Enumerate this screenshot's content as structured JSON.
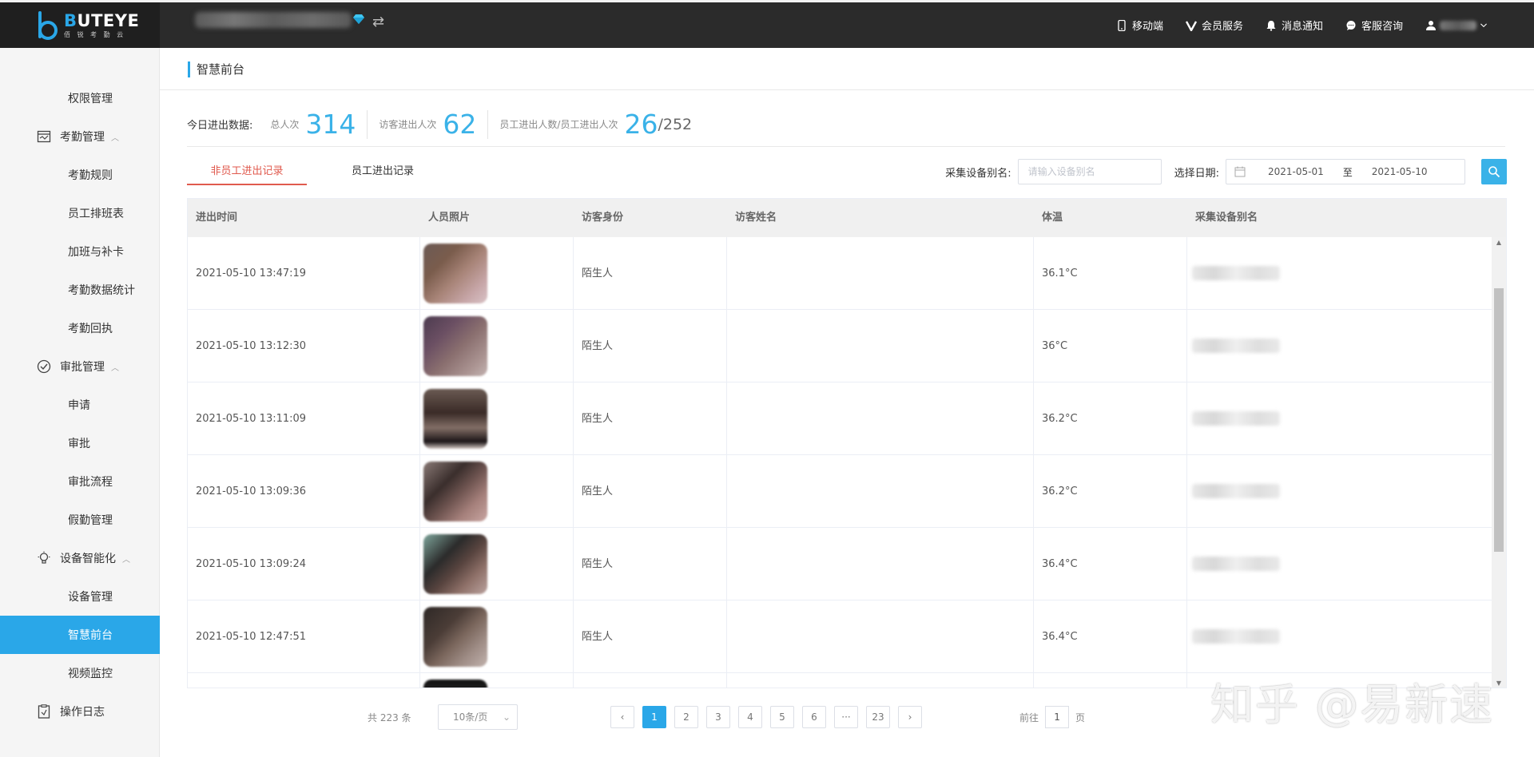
{
  "brand": {
    "name_a": "B",
    "name_b": "UTEYE",
    "tagline": "佰 锐 考 勤 云"
  },
  "topnav": [
    {
      "label": "移动端",
      "icon": "mobile-icon"
    },
    {
      "label": "会员服务",
      "icon": "vip-icon"
    },
    {
      "label": "消息通知",
      "icon": "bell-icon"
    },
    {
      "label": "客服咨询",
      "icon": "chat-icon"
    }
  ],
  "sidebar": {
    "items": [
      {
        "label": "权限管理",
        "type": "sub"
      },
      {
        "label": "考勤管理",
        "type": "group",
        "icon": "calendar-icon"
      },
      {
        "label": "考勤规则",
        "type": "sub"
      },
      {
        "label": "员工排班表",
        "type": "sub"
      },
      {
        "label": "加班与补卡",
        "type": "sub"
      },
      {
        "label": "考勤数据统计",
        "type": "sub"
      },
      {
        "label": "考勤回执",
        "type": "sub"
      },
      {
        "label": "审批管理",
        "type": "group",
        "icon": "check-circle-icon"
      },
      {
        "label": "申请",
        "type": "sub"
      },
      {
        "label": "审批",
        "type": "sub"
      },
      {
        "label": "审批流程",
        "type": "sub"
      },
      {
        "label": "假勤管理",
        "type": "sub"
      },
      {
        "label": "设备智能化",
        "type": "group",
        "icon": "bulb-icon"
      },
      {
        "label": "设备管理",
        "type": "sub"
      },
      {
        "label": "智慧前台",
        "type": "sub",
        "active": true
      },
      {
        "label": "视频监控",
        "type": "sub"
      },
      {
        "label": "操作日志",
        "type": "group",
        "icon": "log-icon"
      }
    ]
  },
  "page": {
    "title": "智慧前台"
  },
  "stats": {
    "lead": "今日进出数据:",
    "total_label": "总人次",
    "total_value": "314",
    "visitor_label": "访客进出人次",
    "visitor_value": "62",
    "staff_label": "员工进出人数/员工进出人次",
    "staff_value": "26",
    "staff_total": "/252"
  },
  "tabs": [
    "非员工进出记录",
    "员工进出记录"
  ],
  "filters": {
    "device_label": "采集设备别名:",
    "device_placeholder": "请输入设备别名",
    "date_label": "选择日期:",
    "date_start": "2021-05-01",
    "date_sep": "至",
    "date_end": "2021-05-10"
  },
  "table": {
    "headers": [
      "进出时间",
      "人员照片",
      "访客身份",
      "访客姓名",
      "体温",
      "采集设备别名"
    ],
    "rows": [
      {
        "time": "2021-05-10 13:47:19",
        "identity": "陌生人",
        "name": "",
        "temp": "36.1°C"
      },
      {
        "time": "2021-05-10 13:12:30",
        "identity": "陌生人",
        "name": "",
        "temp": "36°C"
      },
      {
        "time": "2021-05-10 13:11:09",
        "identity": "陌生人",
        "name": "",
        "temp": "36.2°C"
      },
      {
        "time": "2021-05-10 13:09:36",
        "identity": "陌生人",
        "name": "",
        "temp": "36.2°C"
      },
      {
        "time": "2021-05-10 13:09:24",
        "identity": "陌生人",
        "name": "",
        "temp": "36.4°C"
      },
      {
        "time": "2021-05-10 12:47:51",
        "identity": "陌生人",
        "name": "",
        "temp": "36.4°C"
      },
      {
        "time": "",
        "identity": "",
        "name": "",
        "temp": ""
      }
    ]
  },
  "pagination": {
    "total": "共 223 条",
    "page_size": "10条/页",
    "pages": [
      "1",
      "2",
      "3",
      "4",
      "5",
      "6",
      "···",
      "23"
    ],
    "current": "1",
    "goto_prefix": "前往",
    "goto_value": "1",
    "goto_suffix": "页"
  },
  "watermark": "知乎 @易新速",
  "colors": {
    "accent": "#2aa7e8",
    "tab_active": "#e05a4e",
    "topbar": "#2b2b2b"
  }
}
